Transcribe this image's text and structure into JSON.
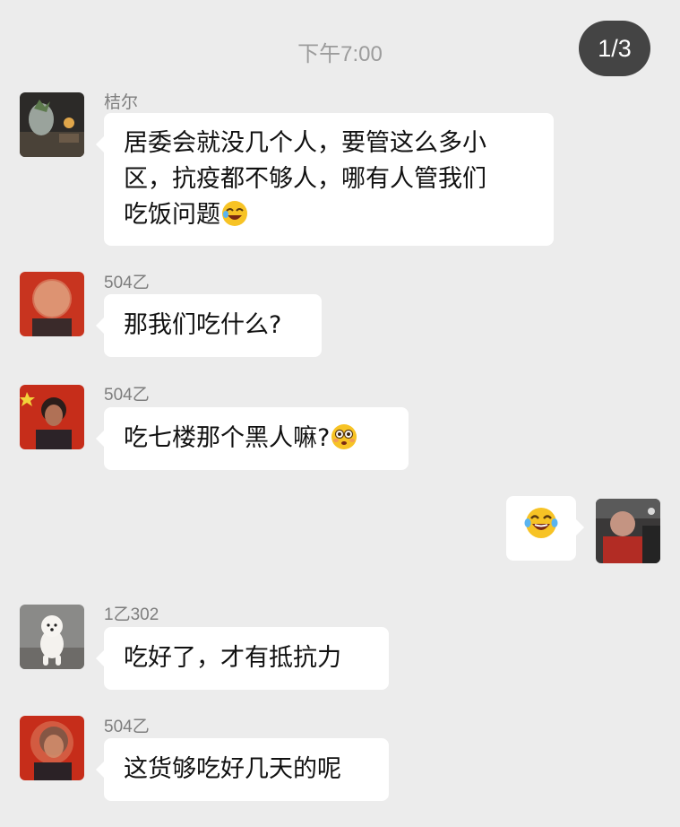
{
  "header": {
    "timestamp": "下午7:00",
    "page_counter": "1/3"
  },
  "messages": [
    {
      "sender": "桔尔",
      "lines": [
        "居委会就没几个人，要管这么多小",
        "区，抗疫都不够人，哪有人管我们",
        "吃饭问题"
      ],
      "trailing_emoji": "rolling-laughing-emoji"
    },
    {
      "sender": "504乙",
      "text": "那我们吃什么?"
    },
    {
      "sender": "504乙",
      "text": "吃七楼那个黑人嘛?",
      "trailing_emoji": "flushed-face-emoji"
    },
    {
      "sender": "",
      "outgoing": true,
      "emoji": "loudly-laughing-emoji"
    },
    {
      "sender": "1乙302",
      "text": "吃好了，才有抵抗力"
    },
    {
      "sender": "504乙",
      "text": "这货够吃好几天的呢"
    }
  ],
  "colors": {
    "background": "#ececec",
    "bubble": "#ffffff",
    "counter_bg": "#444444",
    "emoji_yellow": "#f7c325"
  }
}
